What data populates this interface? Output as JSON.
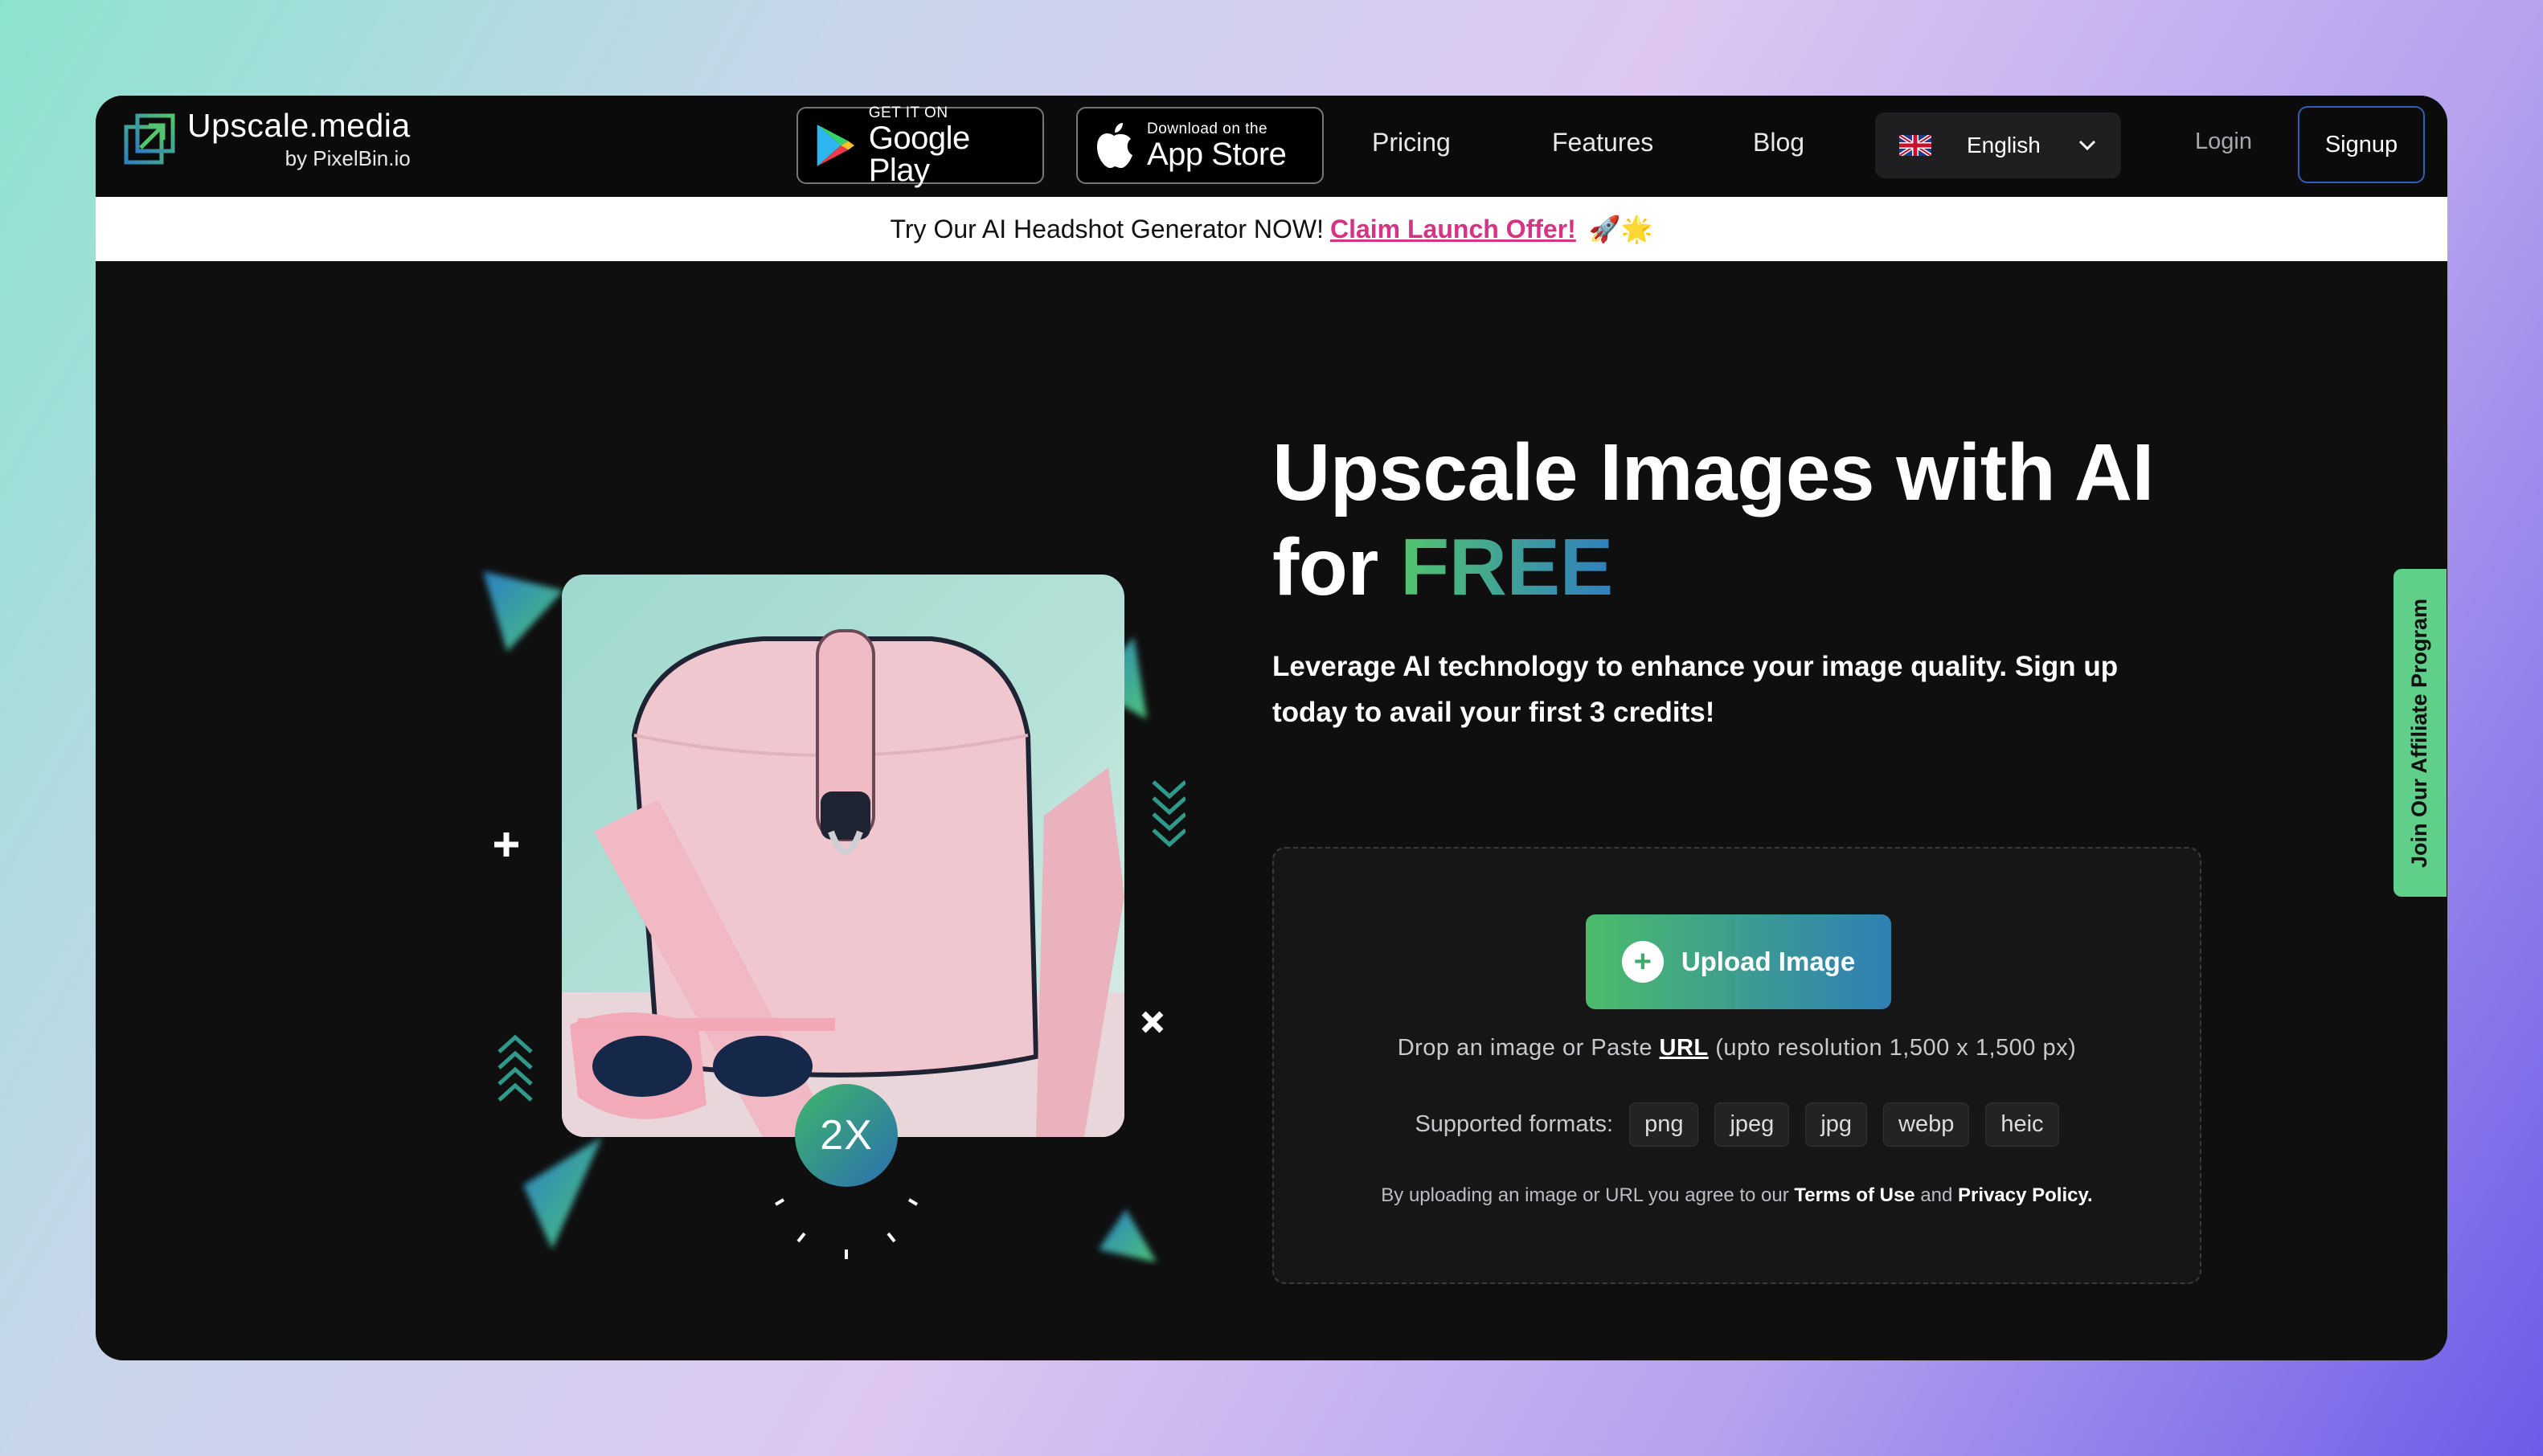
{
  "brand": {
    "title": "Upscale.media",
    "subtitle": "by PixelBin.io"
  },
  "stores": {
    "google": {
      "small": "GET IT ON",
      "big": "Google Play"
    },
    "apple": {
      "small": "Download on the",
      "big": "App Store"
    }
  },
  "nav": {
    "pricing": "Pricing",
    "features": "Features",
    "blog": "Blog"
  },
  "language": {
    "selected": "English"
  },
  "auth": {
    "login": "Login",
    "signup": "Signup"
  },
  "banner": {
    "text": "Try Our AI Headshot Generator NOW!",
    "link": "Claim Launch Offer!",
    "emoji": "🚀🌟"
  },
  "hero": {
    "title_line1": "Upscale Images with AI",
    "title_for": "for",
    "title_free": "FREE",
    "subtitle": "Leverage AI technology to enhance your image quality. Sign up today to avail your first 3 credits!",
    "badge": "2X"
  },
  "upload": {
    "button": "Upload Image",
    "drop_prefix": "Drop an image or Paste",
    "drop_url": "URL",
    "drop_suffix": "(upto resolution 1,500 x 1,500 px)",
    "formats_label": "Supported formats:",
    "formats": [
      "png",
      "jpeg",
      "jpg",
      "webp",
      "heic"
    ],
    "terms_prefix": "By uploading an image or URL you agree to our",
    "terms_link": "Terms of Use",
    "terms_and": "and",
    "privacy_link": "Privacy Policy."
  },
  "affiliate": {
    "label": "Join Our Affiliate Program"
  },
  "colors": {
    "accent_green": "#4cbb6a",
    "accent_blue": "#2f7fb5",
    "banner_link": "#d63384",
    "affiliate_tab": "#5fcf8a"
  }
}
